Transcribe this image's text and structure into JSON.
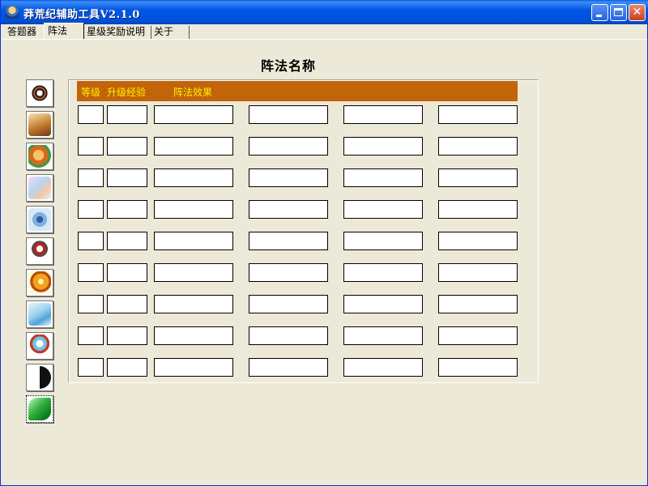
{
  "window": {
    "title": "莽荒纪辅助工具V2.1.0",
    "close_glyph": "✕"
  },
  "tabs": [
    {
      "label": "答题器",
      "selected": false
    },
    {
      "label": "阵法",
      "selected": true
    },
    {
      "label": "星级奖励说明",
      "selected": false
    },
    {
      "label": "关于",
      "selected": false
    }
  ],
  "main": {
    "heading": "阵法名称",
    "headers": {
      "level": "等级",
      "upgrade_exp": "升级经验",
      "effect": "阵法效果"
    },
    "row_count": 9,
    "rows": [
      [
        "",
        "",
        "",
        "",
        "",
        ""
      ],
      [
        "",
        "",
        "",
        "",
        "",
        ""
      ],
      [
        "",
        "",
        "",
        "",
        "",
        ""
      ],
      [
        "",
        "",
        "",
        "",
        "",
        ""
      ],
      [
        "",
        "",
        "",
        "",
        "",
        ""
      ],
      [
        "",
        "",
        "",
        "",
        "",
        ""
      ],
      [
        "",
        "",
        "",
        "",
        "",
        ""
      ],
      [
        "",
        "",
        "",
        "",
        "",
        ""
      ],
      [
        "",
        "",
        "",
        "",
        "",
        ""
      ]
    ]
  },
  "formation_icons": [
    "formation-icon-1",
    "formation-icon-2",
    "formation-icon-3",
    "formation-icon-4",
    "formation-icon-5",
    "formation-icon-6",
    "formation-icon-7",
    "formation-icon-8",
    "formation-icon-9",
    "formation-icon-10",
    "formation-icon-11"
  ],
  "colors": {
    "header_bg": "#c1640a",
    "header_text": "#fff200",
    "window_bg": "#ece9d8",
    "title_bar": "#0058e6"
  }
}
